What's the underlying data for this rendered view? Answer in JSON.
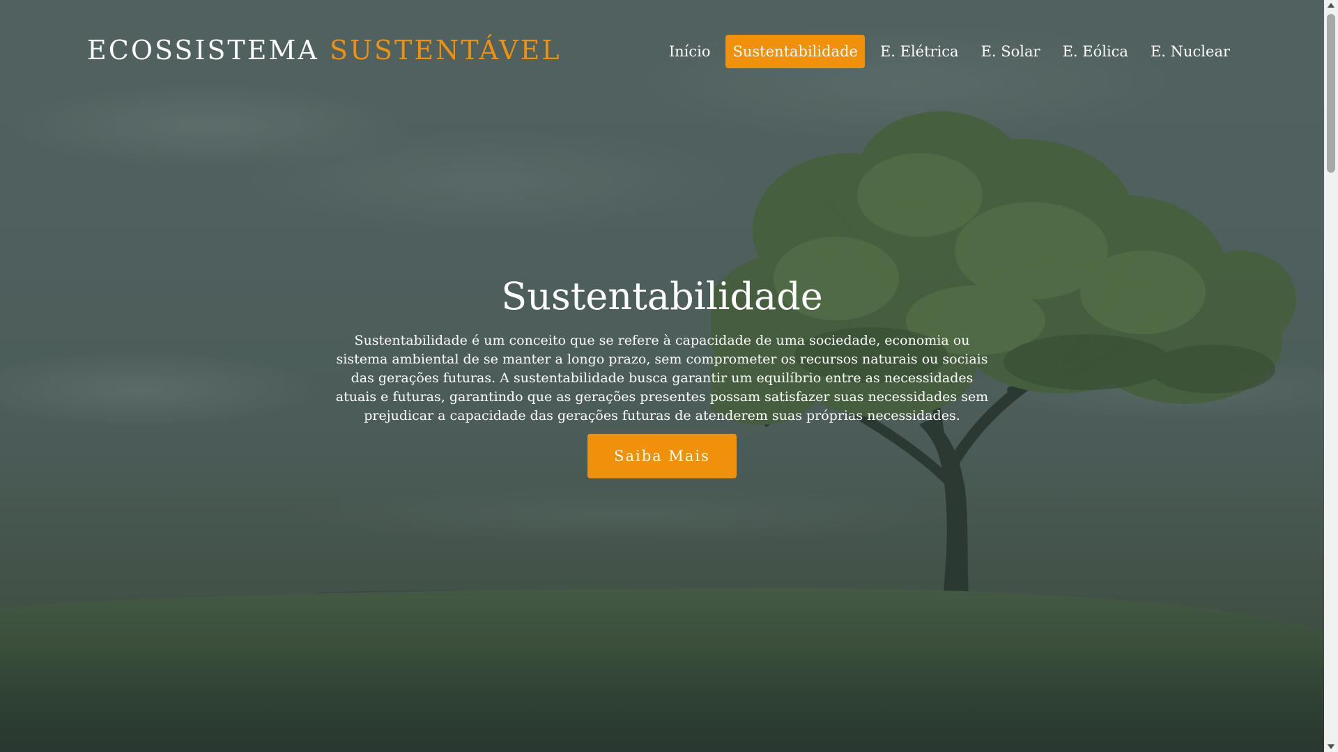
{
  "header": {
    "logo_primary": "ECOSSISTEMA",
    "logo_accent": "SUSTENTÁVEL",
    "nav": [
      {
        "label": "Início",
        "active": false
      },
      {
        "label": "Sustentabilidade",
        "active": true
      },
      {
        "label": "E. Elétrica",
        "active": false
      },
      {
        "label": "E. Solar",
        "active": false
      },
      {
        "label": "E. Eólica",
        "active": false
      },
      {
        "label": "E. Nuclear",
        "active": false
      }
    ]
  },
  "hero": {
    "title": "Sustentabilidade",
    "text": "Sustentabilidade é um conceito que se refere à capacidade de uma sociedade, economia ou sistema ambiental de se manter a longo prazo, sem comprometer os recursos naturais ou sociais das gerações futuras. A sustentabilidade busca garantir um equilíbrio entre as necessidades atuais e futuras, garantindo que as gerações presentes possam satisfazer suas necessidades sem prejudicar a capacidade das gerações futuras de atenderem suas próprias necessidades.",
    "button_label": "Saiba Mais"
  },
  "background": {
    "subject": "lone-tree-on-grass-hill-under-cloudy-sky"
  },
  "colors": {
    "accent": "#f0910c",
    "text": "#ffffff"
  }
}
